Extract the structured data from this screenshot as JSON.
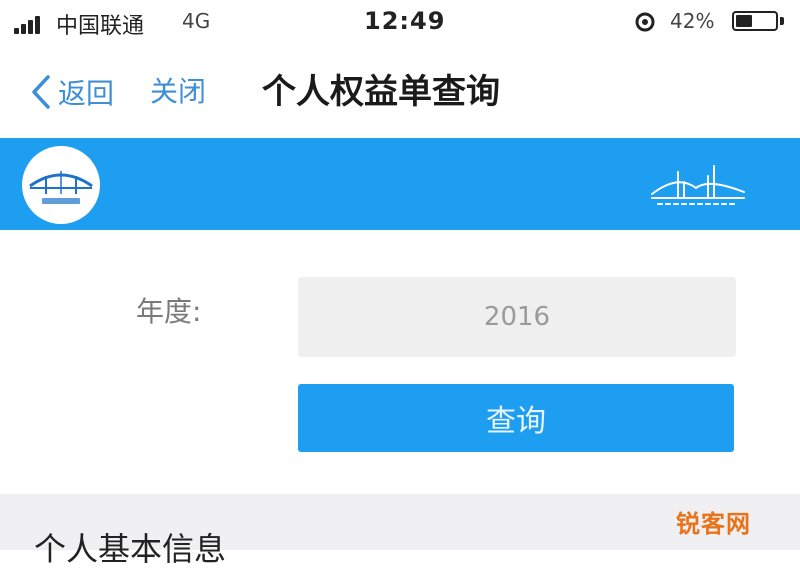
{
  "status_bar": {
    "carrier": "中国联通",
    "network": "4G",
    "time": "12:49",
    "battery": "42%",
    "battery_level": 0.42
  },
  "nav": {
    "back_label": "返回",
    "close_label": "关闭",
    "title": "个人权益单查询"
  },
  "banner": {
    "color": "#1e9ef0",
    "logo_icon": "bridge-logo-icon",
    "decoration_icon": "bridge-outline-icon"
  },
  "form": {
    "year_label": "年度:",
    "year_value": "2016",
    "query_button": "查询"
  },
  "section": {
    "title": "个人基本信息"
  },
  "watermark": {
    "text": "锐客网"
  }
}
